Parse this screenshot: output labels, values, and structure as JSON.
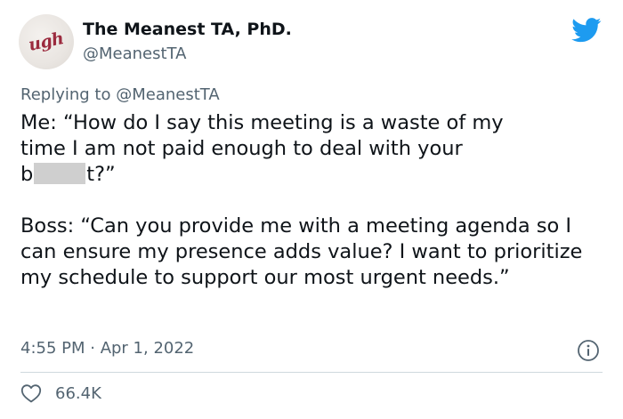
{
  "author": {
    "avatar_text": "ugh",
    "display_name": "The Meanest TA, PhD.",
    "handle": "@MeanestTA"
  },
  "reply": {
    "prefix": "Replying to",
    "mention": "@MeanestTA"
  },
  "body": {
    "line1": "Me: “How do I say this meeting is a waste of my",
    "line2": "time I am not paid enough to deal with your",
    "line3_start": "b",
    "line3_end": "t?”",
    "paragraph2": "Boss: “Can you provide me with a meeting agenda so I can ensure my presence adds value? I want to prioritize my schedule to support our most urgent needs.”"
  },
  "meta": {
    "timestamp": "4:55 PM · Apr 1, 2022"
  },
  "engagement": {
    "likes": "66.4K"
  },
  "colors": {
    "brand": "#1d9bf0",
    "text": "#0f1419",
    "secondary": "#536471",
    "divider": "#cfd9de",
    "redaction": "#cfcfcf"
  },
  "icons": {
    "brand": "twitter-bird-icon",
    "info": "info-icon",
    "like": "heart-icon"
  }
}
